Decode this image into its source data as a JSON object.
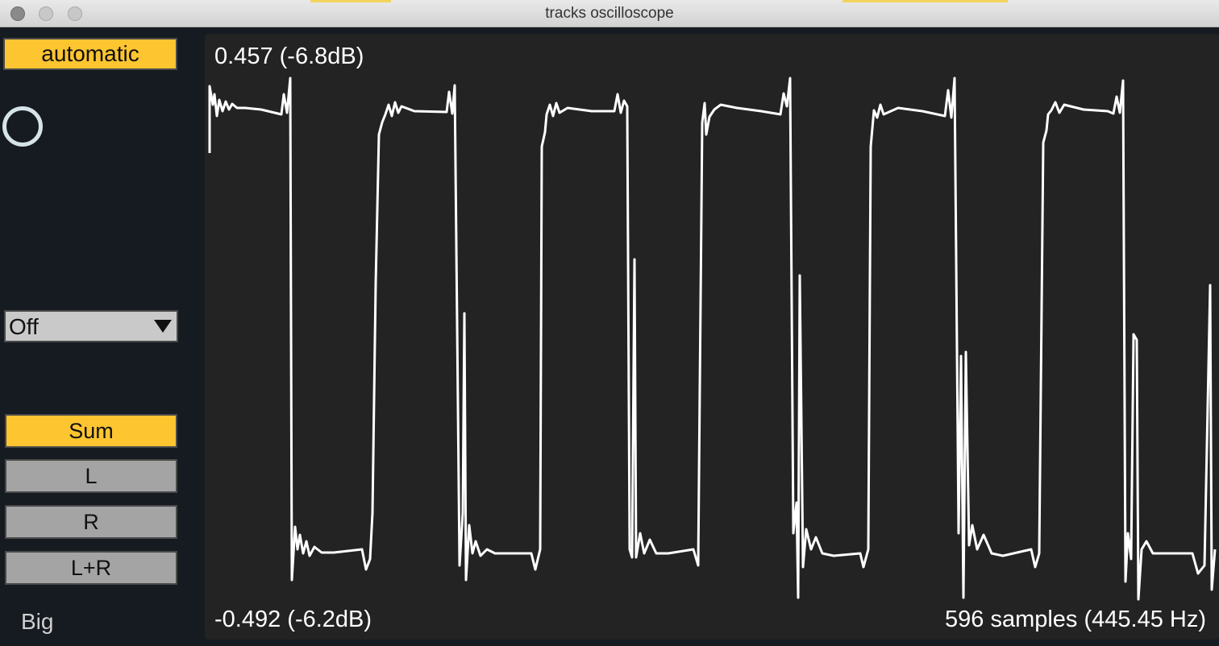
{
  "window": {
    "title": "tracks oscilloscope"
  },
  "sidebar": {
    "scale_mode": "automatic",
    "dropdown": {
      "selected": "Off"
    },
    "channels": [
      {
        "label": "Sum",
        "active": true
      },
      {
        "label": "L",
        "active": false
      },
      {
        "label": "R",
        "active": false
      },
      {
        "label": "L+R",
        "active": false
      }
    ],
    "size_label": "Big"
  },
  "scope": {
    "max_readout": "0.457 (-6.8dB)",
    "min_readout": "-0.492 (-6.2dB)",
    "length_readout": "596 samples (445.45 Hz)",
    "trace_color": "#ffffff",
    "background_color": "#232323",
    "max_value": 0.457,
    "min_value": -0.492,
    "samples": 596,
    "frequency_hz": 445.45
  },
  "colors": {
    "accent": "#fdc530",
    "button_off": "#a4a4a4",
    "panel_bg": "#161b21"
  }
}
